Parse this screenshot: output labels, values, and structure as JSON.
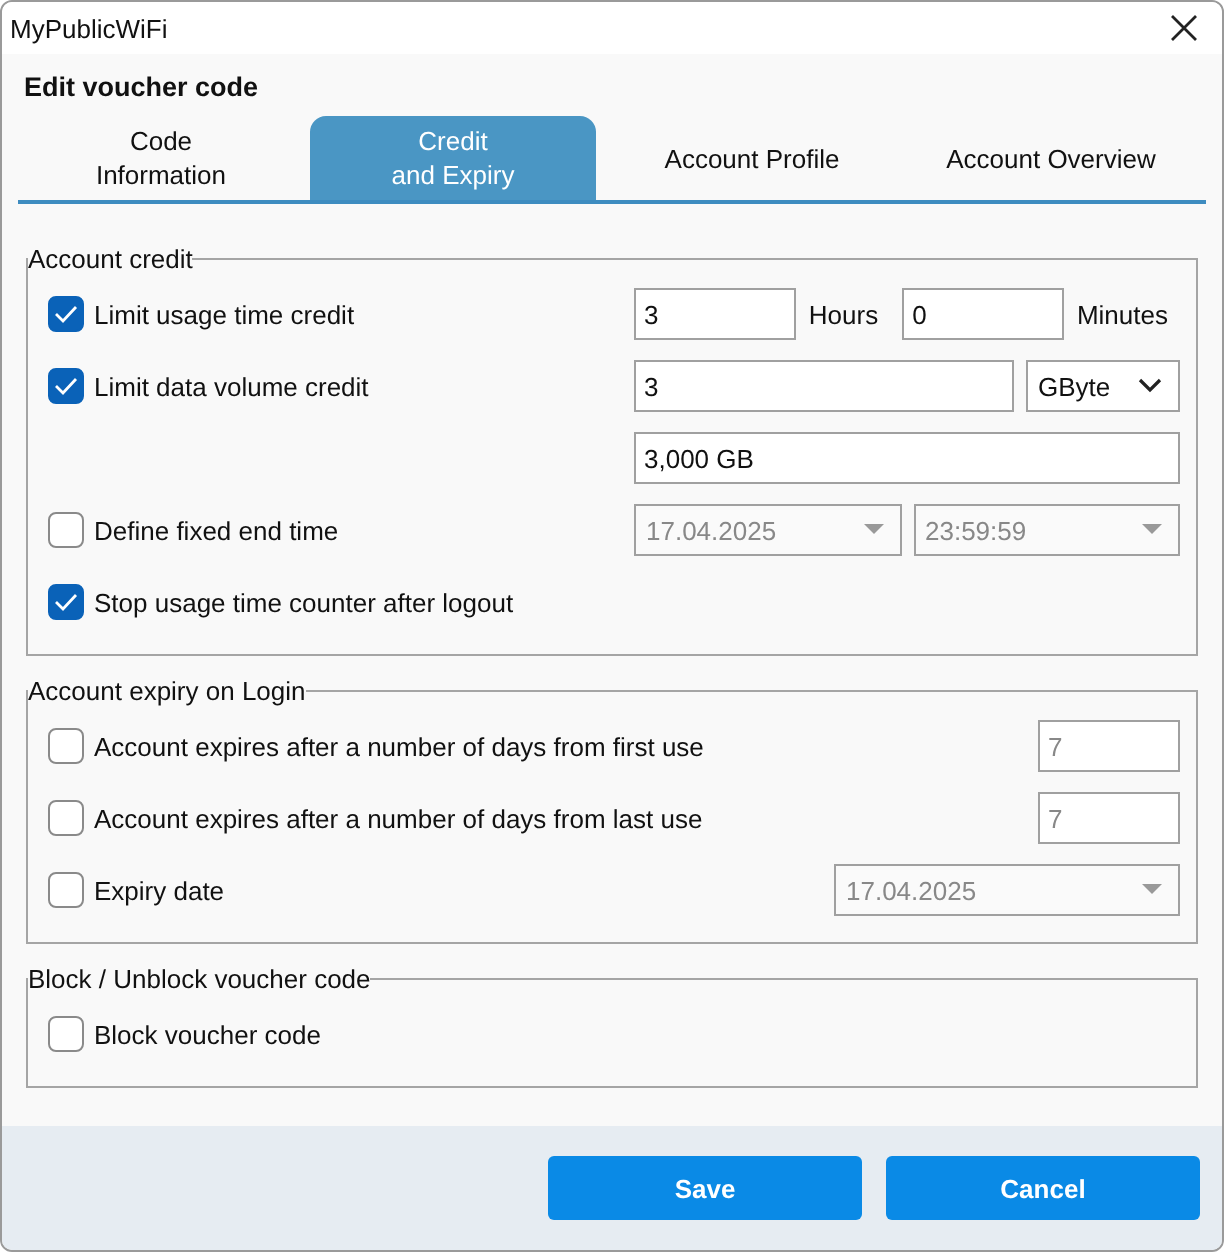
{
  "window": {
    "title": "MyPublicWiFi"
  },
  "dialog_title": "Edit voucher code",
  "tabs": [
    {
      "label": "Code\nInformation",
      "selected": false
    },
    {
      "label": "Credit\nand Expiry",
      "selected": true
    },
    {
      "label": "Account Profile",
      "selected": false
    },
    {
      "label": "Account Overview",
      "selected": false
    }
  ],
  "sections": [
    {
      "title": "Account credit",
      "rows": [
        {
          "checkbox": {
            "label": "Limit usage time credit",
            "checked": true
          },
          "controls": [
            {
              "kind": "input",
              "value": "3",
              "disabled": false
            },
            {
              "kind": "unit",
              "value": "Hours"
            },
            {
              "kind": "input",
              "value": "0",
              "disabled": false
            },
            {
              "kind": "unit",
              "value": "Minutes"
            }
          ]
        },
        {
          "checkbox": {
            "label": "Limit data volume credit",
            "checked": true
          },
          "controls": [
            {
              "kind": "input",
              "value": "3",
              "disabled": false
            },
            {
              "kind": "dropdown",
              "value": "GByte",
              "disabled": false
            }
          ]
        },
        {
          "controls": [
            {
              "kind": "input",
              "value": "3,000 GB",
              "disabled": false
            }
          ]
        },
        {
          "checkbox": {
            "label": "Define fixed end time",
            "checked": false
          },
          "controls": [
            {
              "kind": "dropdown",
              "value": "17.04.2025",
              "disabled": true
            },
            {
              "kind": "dropdown",
              "value": "23:59:59",
              "disabled": true
            }
          ]
        },
        {
          "checkbox": {
            "label": "Stop usage time counter after logout",
            "checked": true
          }
        }
      ]
    },
    {
      "title": "Account expiry on Login",
      "rows": [
        {
          "checkbox": {
            "label": "Account expires after a number of days from first use",
            "checked": false
          },
          "controls": [
            {
              "kind": "input",
              "value": "7",
              "disabled": true
            }
          ]
        },
        {
          "checkbox": {
            "label": "Account expires after a number of days from last use",
            "checked": false
          },
          "controls": [
            {
              "kind": "input",
              "value": "7",
              "disabled": true
            }
          ]
        },
        {
          "checkbox": {
            "label": "Expiry date",
            "checked": false
          },
          "controls": [
            {
              "kind": "dropdown",
              "value": "17.04.2025",
              "disabled": true
            }
          ]
        }
      ]
    },
    {
      "title": "Block / Unblock voucher code",
      "rows": [
        {
          "checkbox": {
            "label": "Block voucher code",
            "checked": false
          }
        }
      ]
    }
  ],
  "buttons": [
    "Save",
    "Cancel"
  ]
}
